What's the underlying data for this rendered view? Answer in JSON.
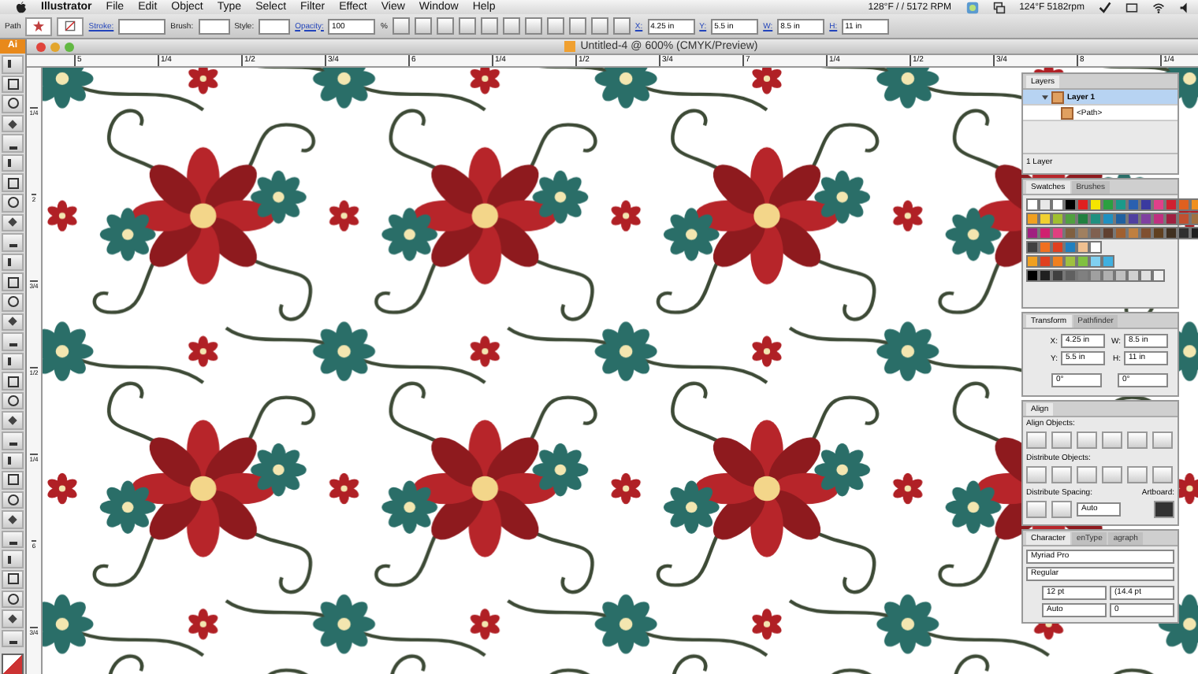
{
  "menu_bar": {
    "app": "Illustrator",
    "items": [
      "File",
      "Edit",
      "Object",
      "Type",
      "Select",
      "Filter",
      "Effect",
      "View",
      "Window",
      "Help"
    ],
    "status": [
      "128°F / / 5172 RPM",
      "124°F 5182rpm"
    ]
  },
  "control_bar": {
    "selection": "Path",
    "stroke_label": "Stroke:",
    "brush_label": "Brush:",
    "style_label": "Style:",
    "opacity_label": "Opacity:",
    "opacity": "100",
    "percent": "%",
    "coords": [
      {
        "label": "X:",
        "value": "4.25 in"
      },
      {
        "label": "Y:",
        "value": "5.5 in"
      },
      {
        "label": "W:",
        "value": "8.5 in"
      },
      {
        "label": "H:",
        "value": "11 in"
      }
    ]
  },
  "toolbar": {
    "logo": "Ai"
  },
  "document": {
    "title": "Untitled-4 @ 600% (CMYK/Preview)",
    "ruler_h": [
      "5",
      "1/4",
      "1/2",
      "3/4",
      "6",
      "1/4",
      "1/2",
      "3/4",
      "7",
      "1/4",
      "1/2",
      "3/4",
      "8",
      "1/4"
    ],
    "ruler_v": [
      "1/4",
      "2",
      "3/4",
      "1/2",
      "1/4",
      "6",
      "3/4"
    ]
  },
  "layers_panel": {
    "tab": "Layers",
    "layers": [
      {
        "name": "Layer 1",
        "selected": true,
        "expanded": true,
        "children": [
          {
            "name": "<Path>",
            "selected": false
          }
        ]
      }
    ],
    "footer": "1 Layer"
  },
  "swatches_panel": {
    "tabs": [
      {
        "label": "Swatches",
        "selected": true
      },
      {
        "label": "Brushes",
        "selected": false
      }
    ],
    "rows": [
      [
        {
          "color": "#ffffff"
        },
        {
          "color": "#e8e8e8"
        },
        {
          "color": "#ffffff"
        },
        {
          "color": "#000000"
        },
        {
          "color": "#e02020"
        },
        {
          "color": "#f5e500"
        },
        {
          "color": "#2aa040"
        },
        {
          "color": "#1a9a8a"
        },
        {
          "color": "#2a60b0"
        },
        {
          "color": "#3a3aa0"
        },
        {
          "color": "#e0408a"
        },
        {
          "color": "#d02030"
        },
        {
          "color": "#e06020"
        },
        {
          "color": "#f09020"
        }
      ],
      [
        {
          "color": "#f0a020"
        },
        {
          "color": "#f0d030"
        },
        {
          "color": "#a0c030"
        },
        {
          "color": "#50a040"
        },
        {
          "color": "#208040"
        },
        {
          "color": "#209080"
        },
        {
          "color": "#2090c0"
        },
        {
          "color": "#2060a0"
        },
        {
          "color": "#5040a0"
        },
        {
          "color": "#8040a0"
        },
        {
          "color": "#c03080"
        },
        {
          "color": "#a02040"
        },
        {
          "color": "#c05030"
        },
        {
          "color": "#a07040"
        }
      ],
      [
        {
          "color": "#a02080"
        },
        {
          "color": "#d02070"
        },
        {
          "color": "#e04080"
        },
        {
          "color": "#806040"
        },
        {
          "color": "#a08060"
        },
        {
          "color": "#806050"
        },
        {
          "color": "#604030"
        },
        {
          "color": "#a06030"
        },
        {
          "color": "#c08040"
        },
        {
          "color": "#805030"
        },
        {
          "color": "#604020"
        },
        {
          "color": "#403020"
        },
        {
          "color": "#303030"
        },
        {
          "color": "#202020"
        }
      ],
      [
        {
          "color": "#404040"
        },
        {
          "color": "#f07020"
        },
        {
          "color": "#e04020"
        },
        {
          "color": "#2080c0"
        },
        {
          "color": "#f0c090"
        },
        {
          "color": "#ffffff"
        }
      ],
      [
        {
          "color": "#f0a020"
        },
        {
          "color": "#e04020"
        },
        {
          "color": "#f08020"
        },
        {
          "color": "#a0c040"
        },
        {
          "color": "#80c040"
        },
        {
          "color": "#80d0f0"
        },
        {
          "color": "#40b0e0"
        }
      ],
      [
        {
          "color": "#000000"
        },
        {
          "color": "#202020"
        },
        {
          "color": "#404040"
        },
        {
          "color": "#606060"
        },
        {
          "color": "#808080"
        },
        {
          "color": "#a0a0a0"
        },
        {
          "color": "#b0b0b0"
        },
        {
          "color": "#c0c0c0"
        },
        {
          "color": "#d0d0d0"
        },
        {
          "color": "#e0e0e0"
        },
        {
          "color": "#f0f0f0"
        }
      ]
    ]
  },
  "transform_panel": {
    "tabs": [
      {
        "label": "Transform",
        "selected": true
      },
      {
        "label": "Pathfinder",
        "selected": false
      }
    ],
    "fields": [
      {
        "label": "X:",
        "value": "4.25 in"
      },
      {
        "label": "W:",
        "value": "8.5 in"
      },
      {
        "label": "Y:",
        "value": "5.5 in"
      },
      {
        "label": "H:",
        "value": "11 in"
      }
    ],
    "angles": [
      "0°",
      "0°"
    ]
  },
  "align_panel": {
    "tab": "Align",
    "sections": [
      "Align Objects:",
      "Distribute Objects:"
    ],
    "spacing_label": "Distribute Spacing:",
    "spacing_value": "Auto",
    "artboard_label": "Artboard:"
  },
  "character_panel": {
    "tabs": [
      {
        "label": "Character",
        "selected": true
      },
      {
        "label": "enType",
        "selected": false
      },
      {
        "label": "agraph",
        "selected": false
      }
    ],
    "font": "Myriad Pro",
    "style": "Regular",
    "size": "12 pt",
    "leading": "(14.4 pt",
    "tracking": "Auto",
    "kerning": "0"
  }
}
